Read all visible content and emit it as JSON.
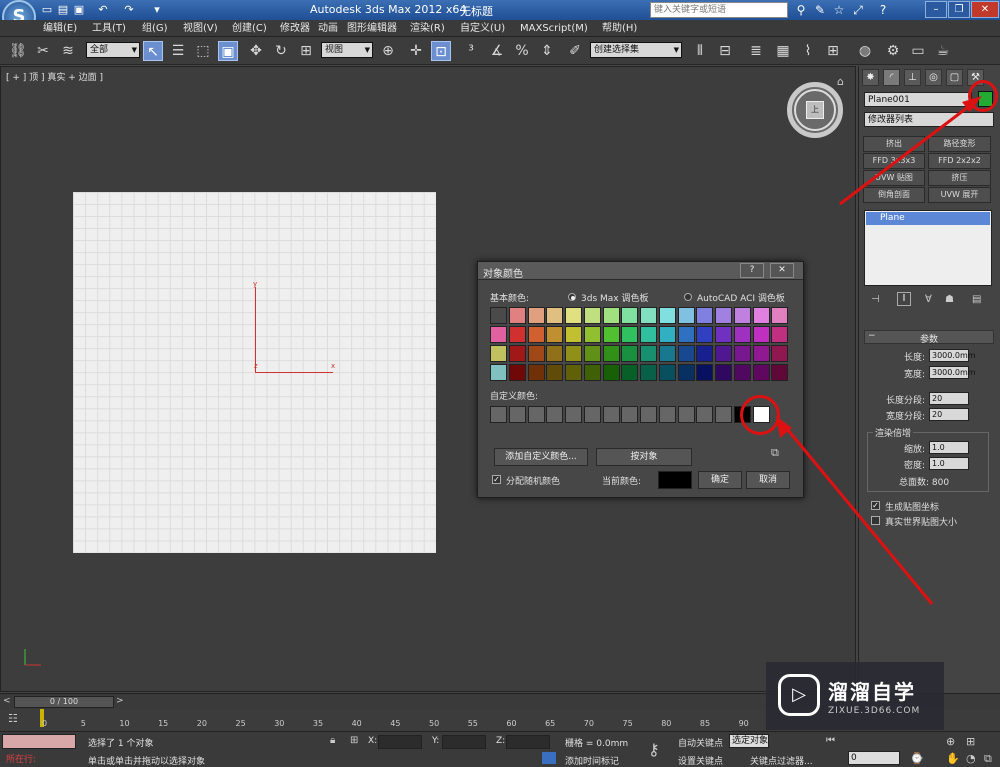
{
  "titlebar": {
    "app_title": "Autodesk 3ds Max  2012 x64",
    "doc_title": "无标题",
    "search_placeholder": "键入关键字或短语",
    "logo_letter": "S"
  },
  "menu": [
    "编辑(E)",
    "工具(T)",
    "组(G)",
    "视图(V)",
    "创建(C)",
    "修改器",
    "动画",
    "图形编辑器",
    "渲染(R)",
    "自定义(U)",
    "MAXScript(M)",
    "帮助(H)"
  ],
  "toolbar": {
    "selection_filter": "全部",
    "ref_coord": "视图",
    "named_selection": "创建选择集"
  },
  "viewport": {
    "label": "[ + ] 顶 ] 真实 + 边面 ]",
    "axis_y": "y",
    "axis_x": "x",
    "axis_z": "z",
    "viewcube_face": "上"
  },
  "dialog": {
    "title": "对象颜色",
    "help": "?",
    "close": "✕",
    "basic_colors_label": "基本颜色:",
    "palette_max": "3ds Max 调色板",
    "palette_acad": "AutoCAD ACI 调色板",
    "custom_colors_label": "自定义颜色:",
    "add_custom_button": "添加自定义颜色...",
    "by_object_button": "按对象",
    "random_colors_label": "分配随机颜色",
    "current_color_label": "当前颜色:",
    "ok_button": "确定",
    "cancel_button": "取消",
    "basic_colors": [
      [
        "#4a4a4a",
        "#e08080",
        "#e0a080",
        "#e0c080",
        "#e0e080",
        "#c0e080",
        "#a0e080",
        "#80e0a0",
        "#80e0c0",
        "#80e0e0",
        "#80c0e0",
        "#8080e0",
        "#a080e0",
        "#c080e0",
        "#e080e0",
        "#e080c0"
      ],
      [
        "#e060a0",
        "#d03030",
        "#d06030",
        "#c09030",
        "#c0c030",
        "#90c030",
        "#50c030",
        "#30c060",
        "#30c0a0",
        "#30b0c0",
        "#3070c0",
        "#3040c0",
        "#7030c0",
        "#a030c0",
        "#c030c0",
        "#c03080"
      ],
      [
        "#c0c060",
        "#a01818",
        "#a04818",
        "#907018",
        "#909018",
        "#609018",
        "#309018",
        "#189040",
        "#189070",
        "#187890",
        "#184890",
        "#182090",
        "#501890",
        "#781890",
        "#901890",
        "#901850"
      ],
      [
        "#80c0c0",
        "#700808",
        "#703008",
        "#604c08",
        "#606008",
        "#406008",
        "#186008",
        "#086028",
        "#086048",
        "#085060",
        "#083060",
        "#081060",
        "#300860",
        "#500860",
        "#600860",
        "#600838"
      ]
    ],
    "custom_colors": [
      "#666666",
      "#666666",
      "#666666",
      "#666666",
      "#666666",
      "#666666",
      "#666666",
      "#666666",
      "#666666",
      "#666666",
      "#666666",
      "#666666",
      "#666666",
      "#000000",
      "#ffffff"
    ],
    "current_color": "#000000"
  },
  "cmdpanel": {
    "object_name": "Plane001",
    "object_color": "#22aa33",
    "modifier_list": "修改器列表",
    "modifier_buttons": [
      "挤出",
      "路径变形",
      "FFD 3x3x3",
      "FFD 2x2x2",
      "UVW 贴图",
      "挤压",
      "倒角剖面",
      "UVW 展开"
    ],
    "stack_item": "Plane",
    "rollout_title": "参数",
    "length_label": "长度:",
    "length_value": "3000.0mm",
    "width_label": "宽度:",
    "width_value": "3000.0mm",
    "length_segs_label": "长度分段:",
    "length_segs_value": "20",
    "width_segs_label": "宽度分段:",
    "width_segs_value": "20",
    "render_mult_label": "渲染倍增",
    "scale_label": "缩放:",
    "scale_value": "1.0",
    "density_label": "密度:",
    "density_value": "1.0",
    "total_faces": "总面数: 800",
    "gen_mapping": "生成贴图坐标",
    "real_world": "真实世界贴图大小"
  },
  "timeline": {
    "frame": "0 / 100",
    "ticks": [
      "0",
      "5",
      "10",
      "15",
      "20",
      "25",
      "30",
      "35",
      "40",
      "45",
      "50",
      "55",
      "60",
      "65",
      "70",
      "75",
      "80",
      "85",
      "90"
    ]
  },
  "status": {
    "in_progress": "所在行:",
    "selected": "选择了 1 个对象",
    "prompt": "单击或单击并拖动以选择对象",
    "x_label": "X:",
    "y_label": "Y:",
    "z_label": "Z:",
    "grid": "栅格 = 0.0mm",
    "add_time_tag": "添加时间标记",
    "auto_key": "自动关键点",
    "selected_obj": "选定对象",
    "set_key": "设置关键点",
    "key_filters": "关键点过滤器...",
    "frame_field": "0"
  },
  "watermark": {
    "title": "溜溜自学",
    "sub": "ZIXUE.3D66.COM"
  }
}
